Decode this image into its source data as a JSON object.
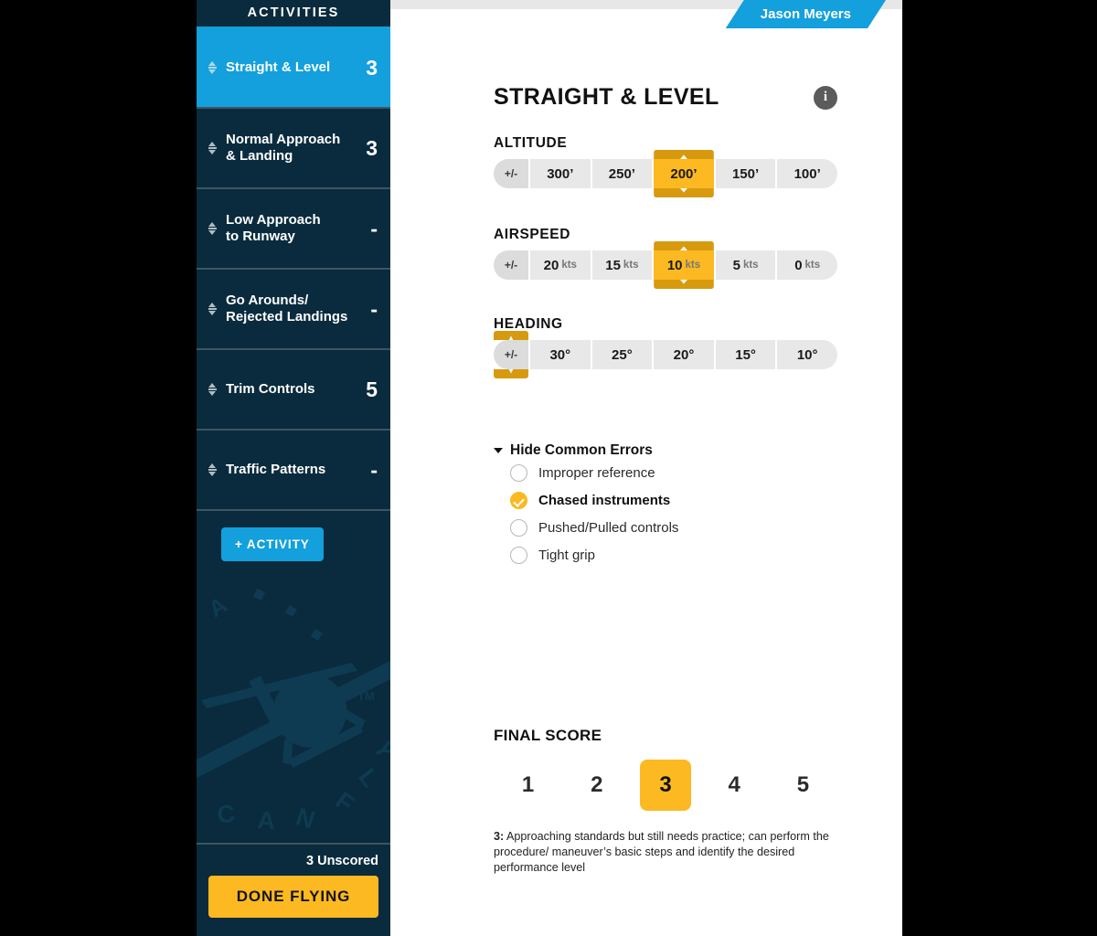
{
  "sidebar": {
    "header": "ACTIVITIES",
    "items": [
      {
        "label": "Straight & Level",
        "score": "3",
        "active": true
      },
      {
        "label": "Normal Approach\n& Landing",
        "score": "3",
        "active": false
      },
      {
        "label": "Low Approach\nto Runway",
        "score": "-",
        "active": false
      },
      {
        "label": "Go Arounds/\nRejected Landings",
        "score": "-",
        "active": false
      },
      {
        "label": "Trim Controls",
        "score": "5",
        "active": false
      },
      {
        "label": "Traffic Patterns",
        "score": "-",
        "active": false
      }
    ],
    "add_activity_label": "+ ACTIVITY",
    "unscored_text": "3 Unscored",
    "done_flying_label": "DONE FLYING",
    "watermark_text": "YOU CAN FLY"
  },
  "header": {
    "student_name": "Jason Meyers"
  },
  "main": {
    "page_title": "STRAIGHT & LEVEL",
    "info_icon_label": "i",
    "tolerance_groups": [
      {
        "label": "ALTITUDE",
        "options": [
          {
            "value": "+/-",
            "unit": "",
            "selected": false,
            "pm": true
          },
          {
            "value": "300’",
            "unit": "",
            "selected": false,
            "pm": false
          },
          {
            "value": "250’",
            "unit": "",
            "selected": false,
            "pm": false
          },
          {
            "value": "200’",
            "unit": "",
            "selected": true,
            "pm": false
          },
          {
            "value": "150’",
            "unit": "",
            "selected": false,
            "pm": false
          },
          {
            "value": "100’",
            "unit": "",
            "selected": false,
            "pm": false
          }
        ]
      },
      {
        "label": "AIRSPEED",
        "options": [
          {
            "value": "+/-",
            "unit": "",
            "selected": false,
            "pm": true
          },
          {
            "value": "20",
            "unit": "kts",
            "selected": false,
            "pm": false
          },
          {
            "value": "15",
            "unit": "kts",
            "selected": false,
            "pm": false
          },
          {
            "value": "10",
            "unit": "kts",
            "selected": true,
            "pm": false
          },
          {
            "value": "5",
            "unit": "kts",
            "selected": false,
            "pm": false
          },
          {
            "value": "0",
            "unit": "kts",
            "selected": false,
            "pm": false
          }
        ]
      },
      {
        "label": "HEADING",
        "options": [
          {
            "value": "+/-",
            "unit": "",
            "selected": true,
            "pm": true
          },
          {
            "value": "30°",
            "unit": "",
            "selected": false,
            "pm": false
          },
          {
            "value": "25°",
            "unit": "",
            "selected": false,
            "pm": false
          },
          {
            "value": "20°",
            "unit": "",
            "selected": false,
            "pm": false
          },
          {
            "value": "15°",
            "unit": "",
            "selected": false,
            "pm": false
          },
          {
            "value": "10°",
            "unit": "",
            "selected": false,
            "pm": false
          }
        ]
      }
    ],
    "common_errors": {
      "toggle_label": "Hide Common Errors",
      "items": [
        {
          "label": "Improper reference",
          "checked": false
        },
        {
          "label": "Chased instruments",
          "checked": true
        },
        {
          "label": "Pushed/Pulled controls",
          "checked": false
        },
        {
          "label": "Tight grip",
          "checked": false
        }
      ]
    },
    "final_score": {
      "label": "FINAL SCORE",
      "options": [
        "1",
        "2",
        "3",
        "4",
        "5"
      ],
      "selected": "3",
      "description_prefix": "3:",
      "description": " Approaching standards but still needs practice; can perform the procedure/ maneuver’s basic steps and identify the desired performance level"
    }
  },
  "colors": {
    "navy": "#0a2b3d",
    "blue": "#13a0dc",
    "gold": "#fcb921",
    "gold_dark": "#d79a0e",
    "chip_gray": "#e8e8e8"
  }
}
